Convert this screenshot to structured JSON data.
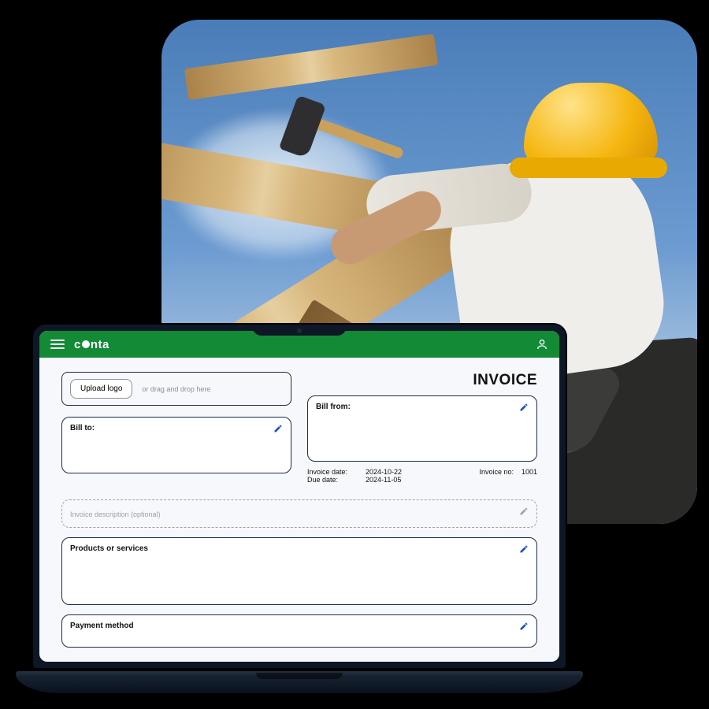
{
  "backdrop": {
    "alt": "construction-worker-hammering-roof-beams"
  },
  "app": {
    "brand": "conta",
    "menu_icon": "menu-icon",
    "user_icon": "user-icon"
  },
  "invoice": {
    "title": "INVOICE",
    "logo": {
      "button": "Upload logo",
      "hint": "or drag and drop here"
    },
    "bill_to_label": "Bill to:",
    "bill_from_label": "Bill from:",
    "dates": {
      "invoice_date_label": "Invoice date:",
      "invoice_date": "2024-10-22",
      "due_date_label": "Due date:",
      "due_date": "2024-11-05"
    },
    "number": {
      "label": "Invoice no:",
      "value": "1001"
    },
    "description_placeholder": "Invoice description (optional)",
    "products_label": "Products or services",
    "payment_label": "Payment method",
    "edit_icon": "pencil-icon"
  },
  "colors": {
    "brand_green": "#138a36",
    "outline_navy": "#1b2b4b",
    "accent_blue": "#1a4fd6"
  }
}
